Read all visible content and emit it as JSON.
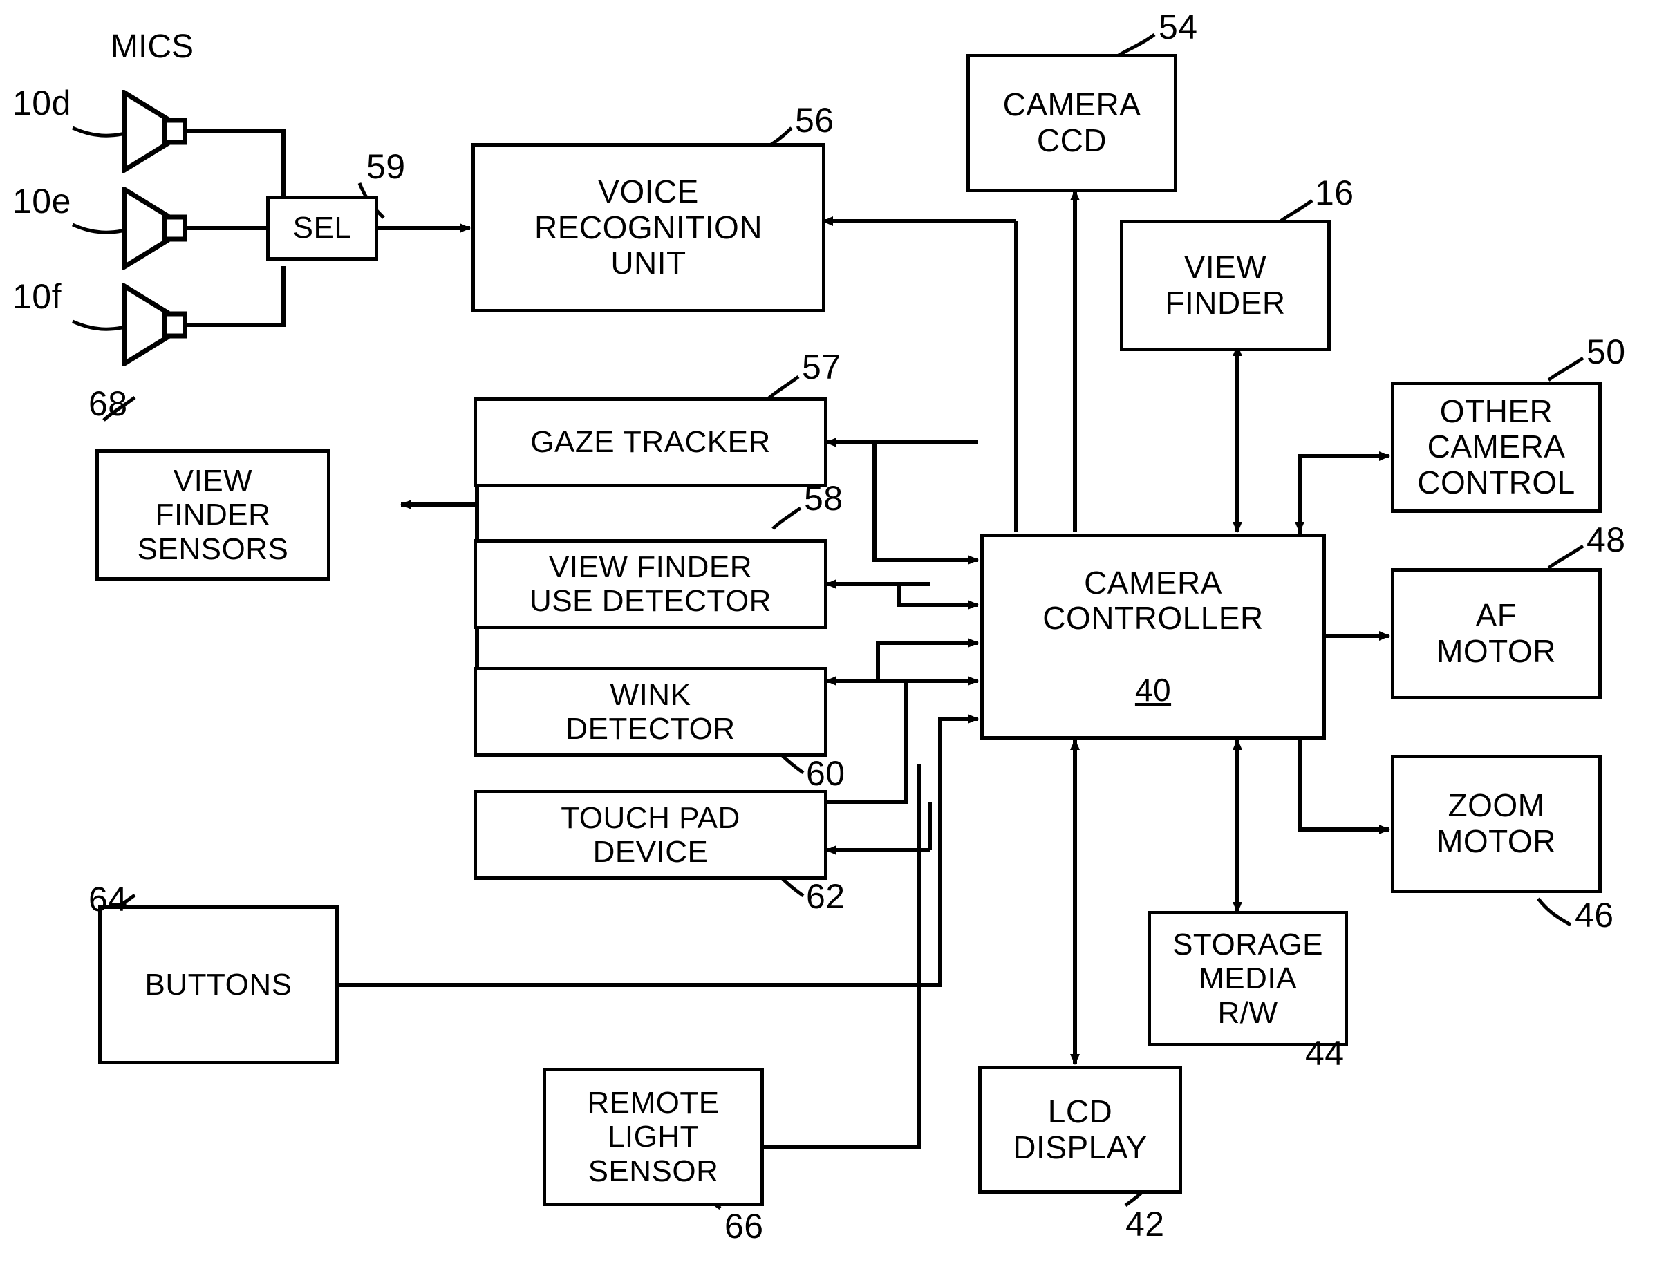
{
  "figure": {
    "title": "MICS",
    "heading_label": "MICS"
  },
  "nodes": {
    "sel": {
      "label": "SEL",
      "ref": "59"
    },
    "voice_recognition_unit": {
      "label": "VOICE\nRECOGNITION\nUNIT",
      "line1": "VOICE",
      "line2": "RECOGNITION",
      "line3": "UNIT",
      "ref": "56"
    },
    "camera_ccd": {
      "line1": "CAMERA",
      "line2": "CCD",
      "ref": "54"
    },
    "view_finder": {
      "line1": "VIEW",
      "line2": "FINDER",
      "ref": "16"
    },
    "other_camera_control": {
      "line1": "OTHER",
      "line2": "CAMERA",
      "line3": "CONTROL",
      "ref": "50"
    },
    "af_motor": {
      "line1": "AF",
      "line2": "MOTOR",
      "ref": "48"
    },
    "zoom_motor": {
      "line1": "ZOOM",
      "line2": "MOTOR",
      "ref": "46"
    },
    "camera_controller": {
      "line1": "CAMERA",
      "line2": "CONTROLLER",
      "ref_inside": "40"
    },
    "gaze_tracker": {
      "line1": "GAZE TRACKER",
      "ref": "57"
    },
    "view_finder_use_detector": {
      "line1": "VIEW FINDER",
      "line2": "USE DETECTOR",
      "ref": "58"
    },
    "wink_detector": {
      "line1": "WINK",
      "line2": "DETECTOR",
      "ref": "60"
    },
    "touch_pad_device": {
      "line1": "TOUCH PAD",
      "line2": "DEVICE",
      "ref": "62"
    },
    "view_finder_sensors": {
      "line1": "VIEW",
      "line2": "FINDER",
      "line3": "SENSORS",
      "ref": "68"
    },
    "buttons": {
      "line1": "BUTTONS",
      "ref": "64"
    },
    "remote_light_sensor": {
      "line1": "REMOTE",
      "line2": "LIGHT",
      "line3": "SENSOR",
      "ref": "66"
    },
    "lcd_display": {
      "line1": "LCD",
      "line2": "DISPLAY",
      "ref": "42"
    },
    "storage_media_rw": {
      "line1": "STORAGE",
      "line2": "MEDIA",
      "line3": "R/W",
      "ref": "44"
    }
  },
  "microphones": [
    {
      "ref": "10d"
    },
    {
      "ref": "10e"
    },
    {
      "ref": "10f"
    }
  ],
  "colors": {
    "stroke": "#000000",
    "background": "#ffffff"
  }
}
